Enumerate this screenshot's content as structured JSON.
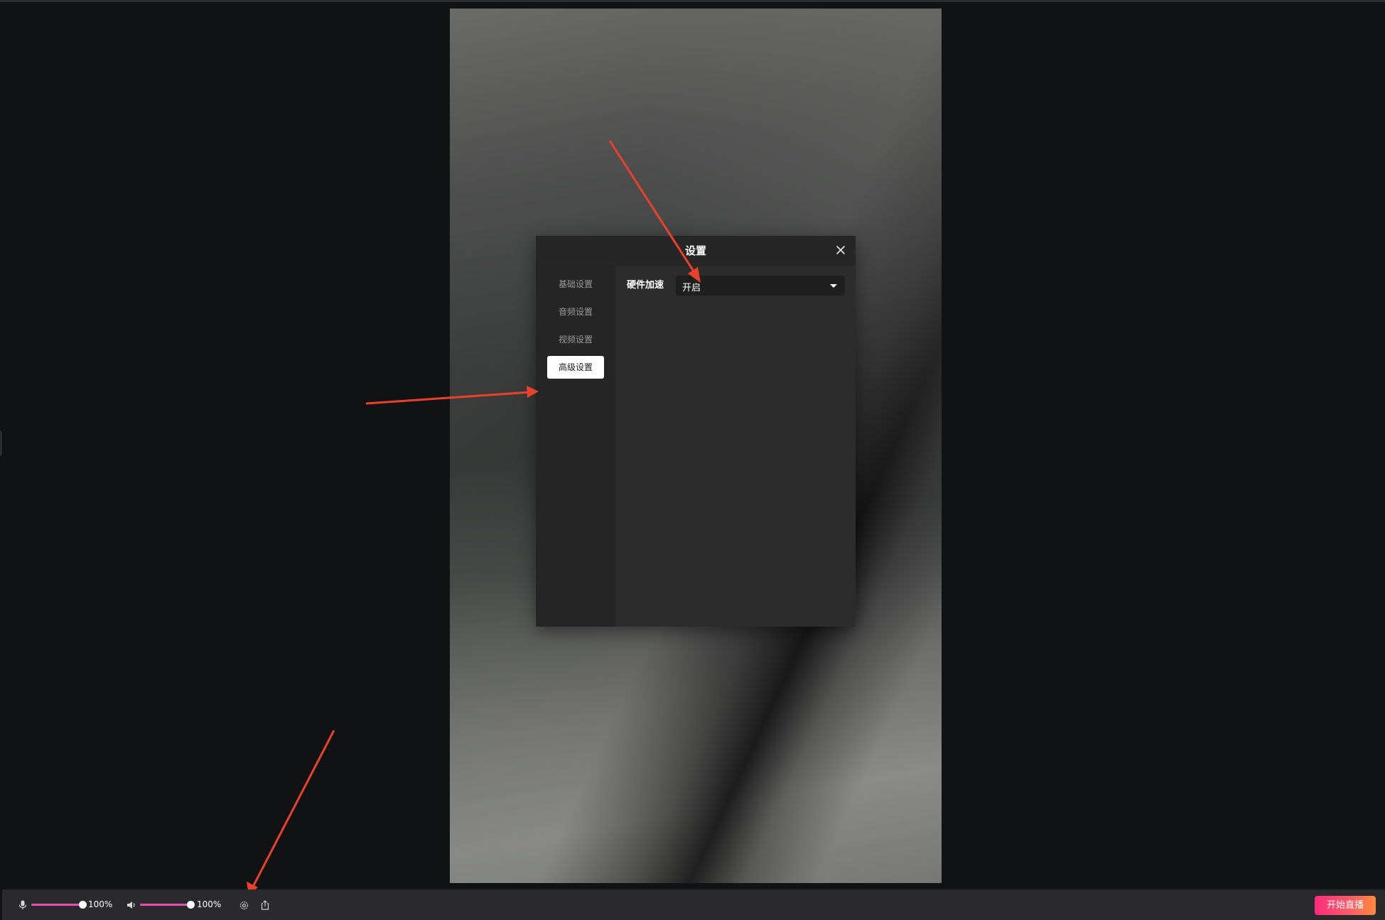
{
  "dialog": {
    "title": "设置",
    "nav": [
      "基础设置",
      "音频设置",
      "视频设置",
      "高级设置"
    ],
    "active_nav": "高级设置",
    "field": {
      "label": "硬件加速",
      "value": "开启"
    }
  },
  "toolbar": {
    "mic_volume": "100%",
    "speaker_volume": "100%",
    "mic_level": 1.0,
    "speaker_level": 1.0,
    "start_label": "开始直播"
  },
  "icons": {
    "close": "close-icon",
    "mic": "microphone-icon",
    "speaker": "speaker-icon",
    "settings": "settings-icon",
    "share": "share-icon",
    "dropdown": "chevron-down-icon"
  },
  "colors": {
    "background": "#111214",
    "accent_slider": "#e84fb4",
    "start_button_from": "#fe2c7f",
    "start_button_to": "#ff8a3d",
    "annotation_arrow": "#e8412c"
  }
}
